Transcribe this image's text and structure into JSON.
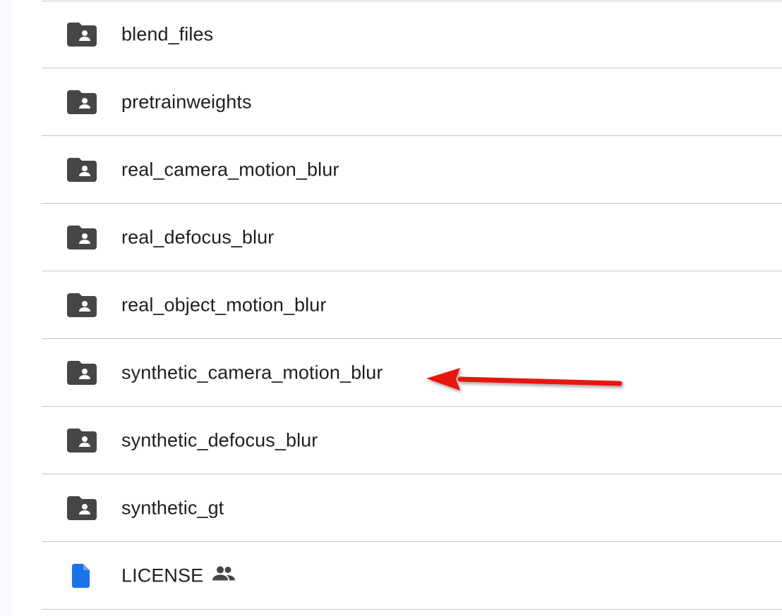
{
  "files": [
    {
      "name": "blend_files",
      "type": "shared-folder"
    },
    {
      "name": "pretrainweights",
      "type": "shared-folder"
    },
    {
      "name": "real_camera_motion_blur",
      "type": "shared-folder"
    },
    {
      "name": "real_defocus_blur",
      "type": "shared-folder"
    },
    {
      "name": "real_object_motion_blur",
      "type": "shared-folder"
    },
    {
      "name": "synthetic_camera_motion_blur",
      "type": "shared-folder"
    },
    {
      "name": "synthetic_defocus_blur",
      "type": "shared-folder"
    },
    {
      "name": "synthetic_gt",
      "type": "shared-folder"
    },
    {
      "name": "LICENSE",
      "type": "document",
      "shared": true
    }
  ],
  "annotation": {
    "type": "arrow",
    "color": "#e8140f",
    "points_to": "synthetic_camera_motion_blur"
  },
  "colors": {
    "folder_icon": "#444746",
    "doc_icon": "#1a73e8",
    "divider": "#c4c7c5",
    "text": "#1f1f1f"
  }
}
